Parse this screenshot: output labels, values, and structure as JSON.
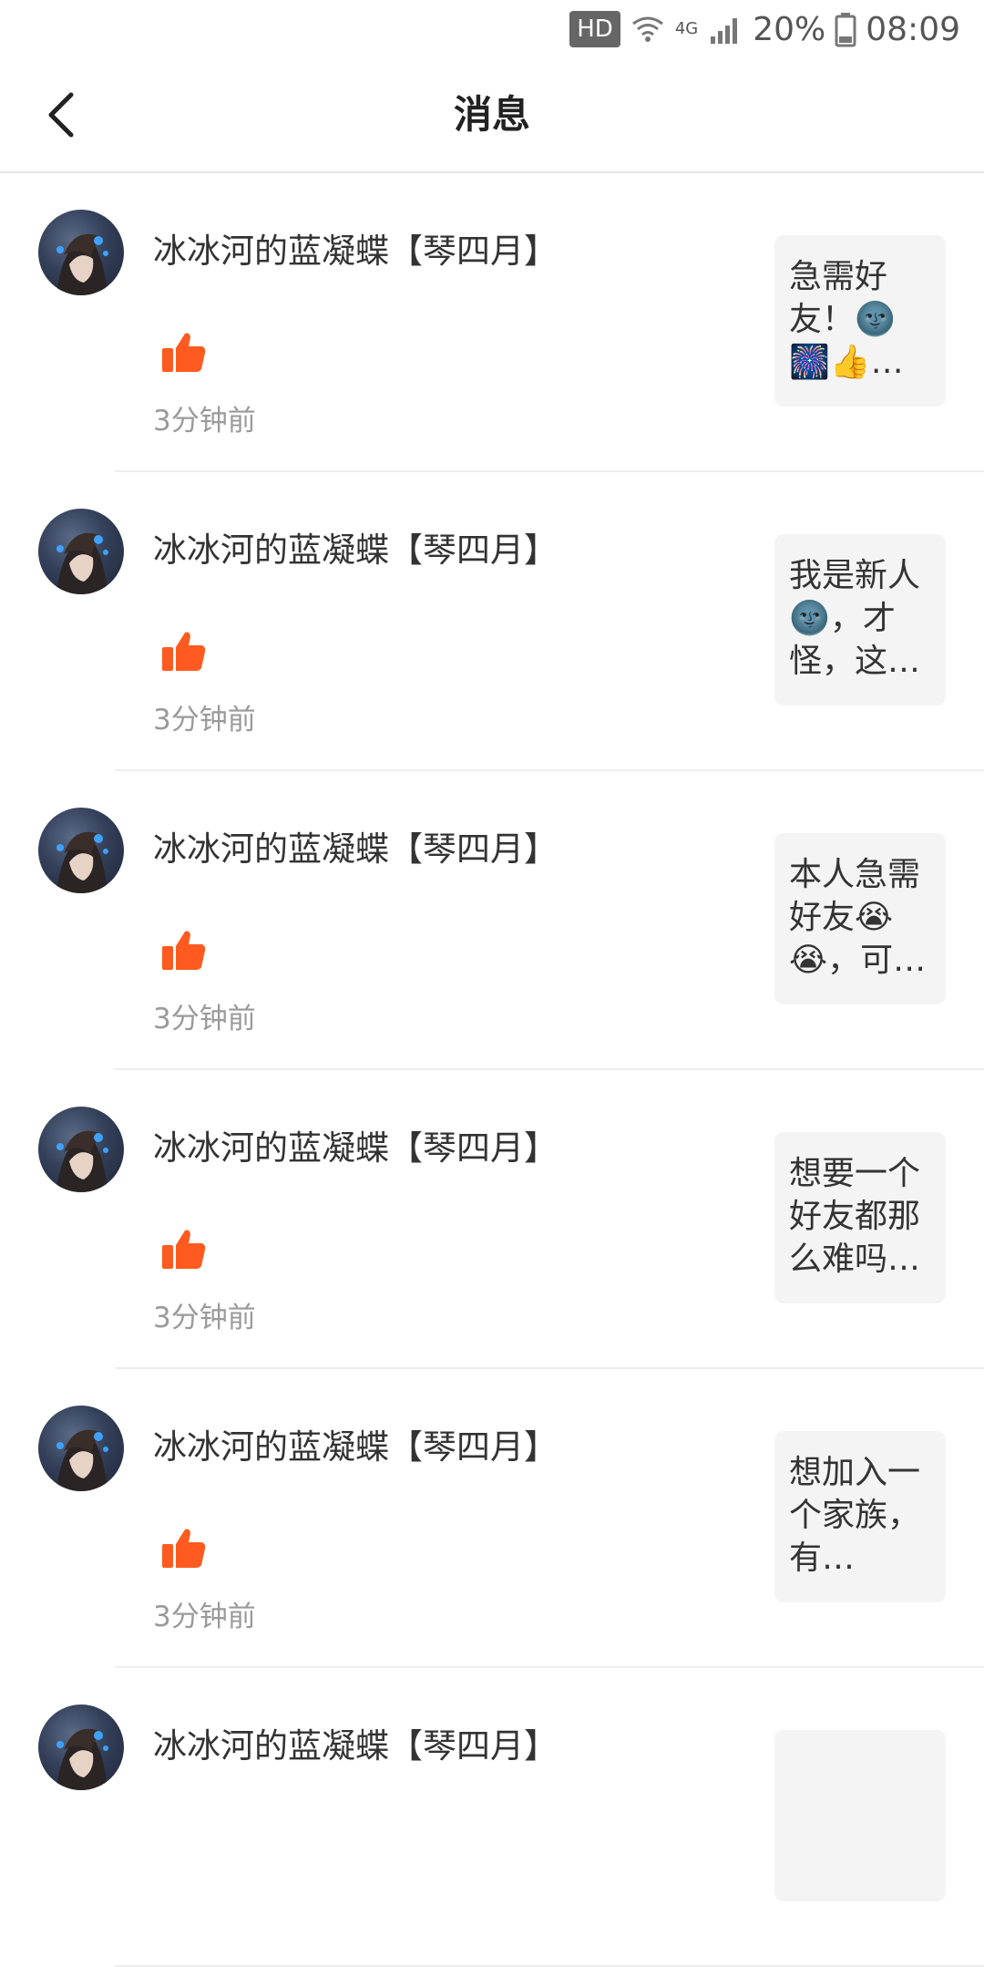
{
  "status_bar": {
    "hd_label": "HD",
    "network_label": "4G",
    "battery_percent": "20%",
    "time": "08:09",
    "icons": [
      "wifi-icon",
      "signal-4g-icon",
      "cell-signal-icon",
      "battery-icon"
    ]
  },
  "nav": {
    "title": "消息",
    "back_icon": "chevron-left-icon"
  },
  "colors": {
    "like": "#ff5a1f",
    "time_text": "#9a9a9a",
    "card_bg": "#f4f4f4"
  },
  "messages": [
    {
      "sender": "冰冰河的蓝凝蝶【琴四月】",
      "action_icon": "thumbs-up-icon",
      "time": "3分钟前",
      "preview": "急需好友！🌚🎆👍…"
    },
    {
      "sender": "冰冰河的蓝凝蝶【琴四月】",
      "action_icon": "thumbs-up-icon",
      "time": "3分钟前",
      "preview": "我是新人🌚，才怪，这…"
    },
    {
      "sender": "冰冰河的蓝凝蝶【琴四月】",
      "action_icon": "thumbs-up-icon",
      "time": "3分钟前",
      "preview": "本人急需好友😭😭，可…"
    },
    {
      "sender": "冰冰河的蓝凝蝶【琴四月】",
      "action_icon": "thumbs-up-icon",
      "time": "3分钟前",
      "preview": "想要一个好友都那么难吗…"
    },
    {
      "sender": "冰冰河的蓝凝蝶【琴四月】",
      "action_icon": "thumbs-up-icon",
      "time": "3分钟前",
      "preview": "想加入一个家族，有…"
    },
    {
      "sender": "冰冰河的蓝凝蝶【琴四月】",
      "action_icon": "thumbs-up-icon",
      "time": "",
      "preview": ""
    }
  ]
}
